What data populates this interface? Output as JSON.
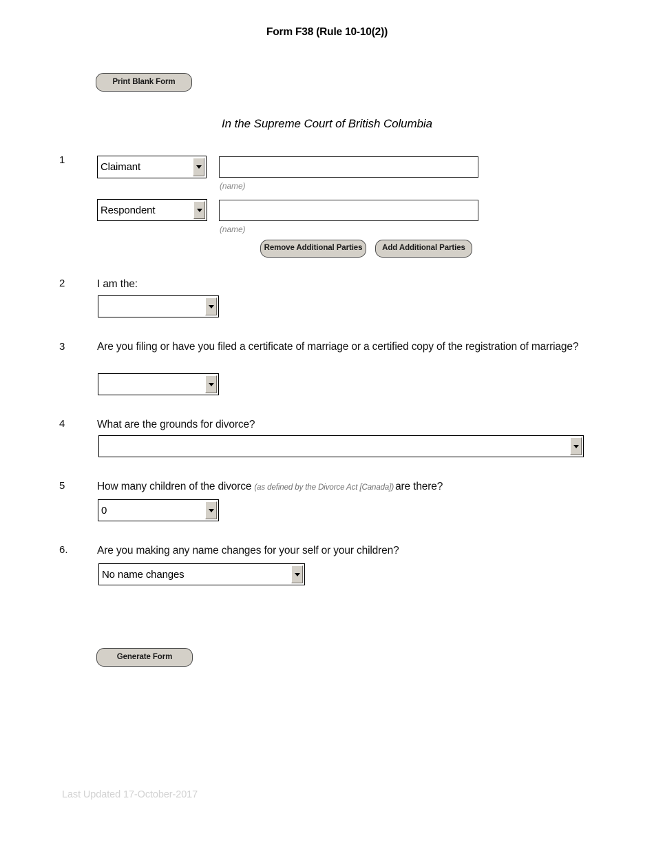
{
  "document": {
    "title": "Form F38 (Rule 10-10(2))",
    "court_heading": "In the Supreme Court of British Columbia",
    "footer": "Last Updated 17-October-2017"
  },
  "toolbar": {
    "print_blank_form": "Print Blank Form",
    "generate_form": "Generate Form"
  },
  "parties": {
    "number": "1",
    "rows": [
      {
        "role_value": "Claimant",
        "role_options": [
          "Claimant",
          "Respondent"
        ],
        "name_value": "",
        "name_caption": "(name)"
      },
      {
        "role_value": "Respondent",
        "role_options": [
          "Claimant",
          "Respondent"
        ],
        "name_value": "",
        "name_caption": "(name)"
      }
    ],
    "remove_button": "Remove Additional Parties",
    "add_button": "Add Additional Parties"
  },
  "questions": [
    {
      "number": "2",
      "text": "I am the:",
      "note": "",
      "select_value": ""
    },
    {
      "number": "3",
      "text": "Are you filing or have you filed a certificate of marriage or a certified copy of the registration of marriage?",
      "note": "",
      "select_value": ""
    },
    {
      "number": "4",
      "text": "What are the grounds for divorce?",
      "note": "",
      "select_value": ""
    },
    {
      "number": "5",
      "text_before": "How many children of the divorce",
      "note": "(as defined by the Divorce Act [Canada])",
      "text_after": "are there?",
      "select_value": "0"
    },
    {
      "number": "6.",
      "text": "Are you making any name changes for your self or your children?",
      "note": "",
      "select_value": "No name changes"
    }
  ],
  "colors": {
    "button_face": "#d4d0c8",
    "field_border": "#000000",
    "muted_text": "#8a8a8a",
    "footer_text": "#d2d2d2"
  }
}
